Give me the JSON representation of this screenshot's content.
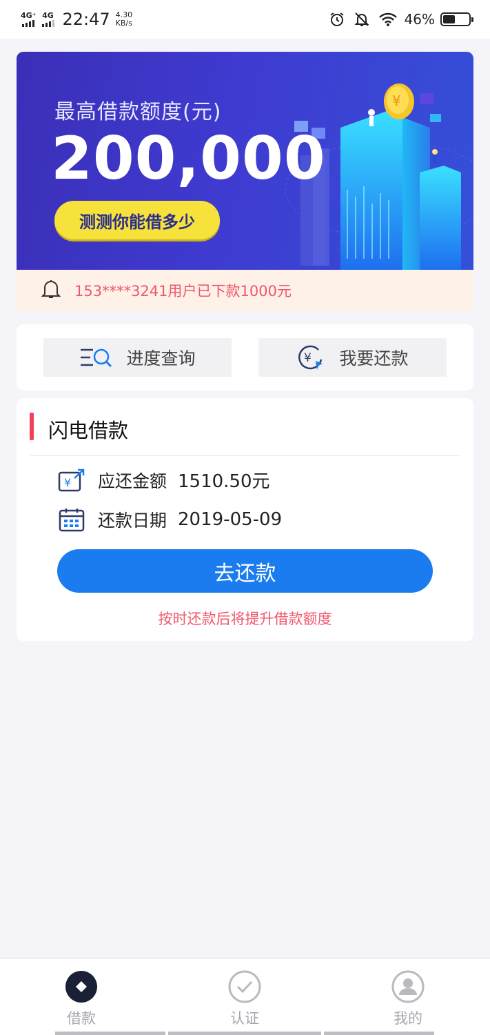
{
  "status_bar": {
    "network_1": "4G⁺",
    "network_2": "4G",
    "time": "22:47",
    "speed_value": "4.30",
    "speed_unit": "KB/s",
    "battery_percent": "46%",
    "battery_level": 0.46,
    "icons": [
      "alarm-icon",
      "bell-off-icon",
      "wifi-icon",
      "battery-icon"
    ]
  },
  "banner": {
    "subtitle": "最高借款额度(元)",
    "amount": "200,000",
    "cta_label": "测测你能借多少"
  },
  "notice": {
    "icon": "bell-icon",
    "text": "153****3241用户已下款1000元"
  },
  "quick_actions": {
    "progress_label": "进度查询",
    "repay_label": "我要还款"
  },
  "loan": {
    "title": "闪电借款",
    "amount_label": "应还金额",
    "amount_value": "1510.50元",
    "date_label": "还款日期",
    "date_value": "2019-05-09",
    "pay_button": "去还款",
    "tip": "按时还款后将提升借款额度"
  },
  "bottom_nav": {
    "items": [
      {
        "label": "借款",
        "icon": "loan-diamond-icon",
        "active": true
      },
      {
        "label": "认证",
        "icon": "check-circle-icon",
        "active": false
      },
      {
        "label": "我的",
        "icon": "user-circle-icon",
        "active": false
      }
    ]
  },
  "colors": {
    "accent_red": "#f0405a",
    "notice_pink": "#f0566b",
    "primary_blue": "#1b7cf0",
    "banner_blue": "#3f3ad0",
    "cta_yellow": "#f6e23a"
  }
}
